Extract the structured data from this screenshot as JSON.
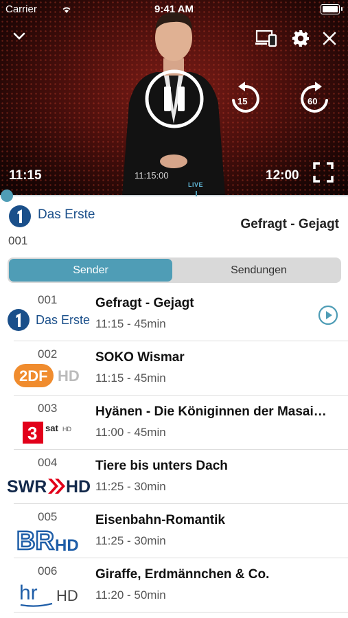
{
  "status_bar": {
    "carrier": "Carrier",
    "time": "9:41 AM"
  },
  "player": {
    "current_time": "11:15",
    "position_time": "11:15:00",
    "end_time": "12:00",
    "live_label": "LIVE",
    "skip_back_seconds": "15",
    "skip_forward_seconds": "60",
    "state": "playing"
  },
  "current_channel": {
    "name": "Das Erste",
    "number": "001",
    "show": "Gefragt - Gejagt"
  },
  "tabs": {
    "active": "Sender",
    "inactive": "Sendungen"
  },
  "channels": [
    {
      "number": "001",
      "title": "Gefragt - Gejagt",
      "meta": "11:15 - 45min",
      "logo": "Das Erste"
    },
    {
      "number": "002",
      "title": "SOKO Wismar",
      "meta": "11:15 - 45min",
      "logo": "ZDF HD"
    },
    {
      "number": "003",
      "title": "Hyänen - Die Königinnen der Masai…",
      "meta": "11:00 - 45min",
      "logo": "3sat HD"
    },
    {
      "number": "004",
      "title": "Tiere bis unters Dach",
      "meta": "11:25 - 30min",
      "logo": "SWR HD"
    },
    {
      "number": "005",
      "title": "Eisenbahn-Romantik",
      "meta": "11:25 - 30min",
      "logo": "BR HD"
    },
    {
      "number": "006",
      "title": "Giraffe, Erdmännchen & Co.",
      "meta": "11:20 - 50min",
      "logo": "hr HD"
    }
  ],
  "colors": {
    "accent": "#4f9db6",
    "ard_blue": "#1a4f8a",
    "zdf_orange": "#f08c2e",
    "swr_red": "#e2001a",
    "br_blue": "#1f5ea8"
  }
}
